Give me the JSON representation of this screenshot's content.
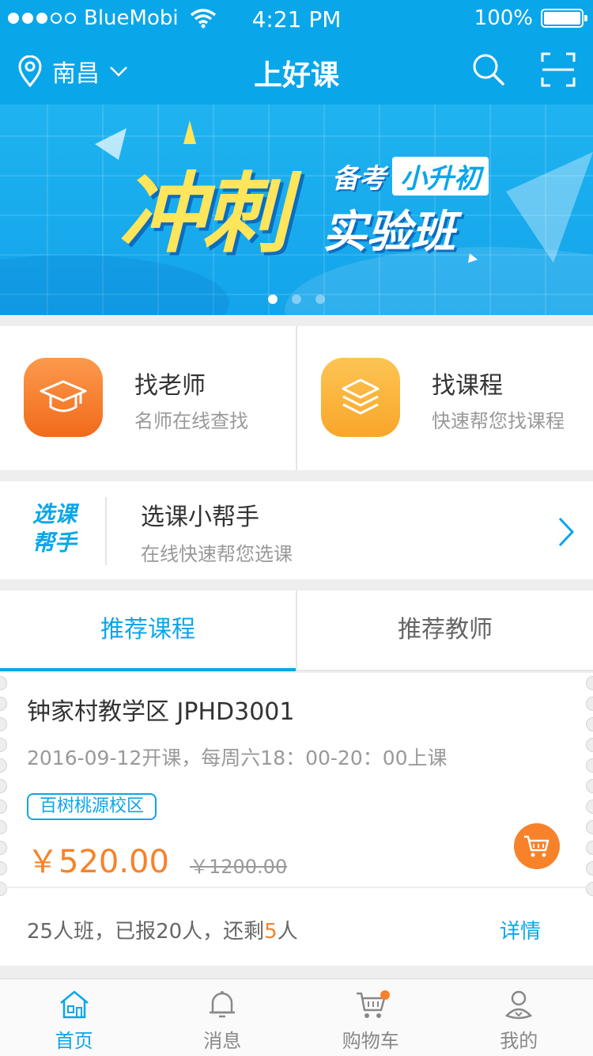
{
  "status_bar": {
    "carrier": "BlueMobi",
    "time": "4:21 PM",
    "battery": "100%"
  },
  "nav": {
    "city": "南昌",
    "title": "上好课"
  },
  "banner": {
    "big_text": "冲刺",
    "sub_prefix": "备考",
    "sub_tag": "小升初",
    "sub_main": "实验班",
    "page_count": 3,
    "active_page": 1
  },
  "quick_entries": [
    {
      "title": "找老师",
      "desc": "名师在线查找",
      "icon": "graduation-cap-icon",
      "color": "#f7822a"
    },
    {
      "title": "找课程",
      "desc": "快速帮您找课程",
      "icon": "layers-icon",
      "color": "#fbb03b"
    }
  ],
  "helper": {
    "logo_line1": "选课",
    "logo_line2": "帮手",
    "title": "选课小帮手",
    "desc": "在线快速帮您选课"
  },
  "tabs": [
    {
      "label": "推荐课程",
      "active": true
    },
    {
      "label": "推荐教师",
      "active": false
    }
  ],
  "course": {
    "title": "钟家村教学区 JPHD3001",
    "time": "2016-09-12开课，每周六18：00-20：00上课",
    "campus": "百树桃源校区",
    "price": "￥520.00",
    "original_price": "￥1200.00",
    "enroll_prefix": "25人班，已报20人，还剩",
    "remaining": "5",
    "enroll_suffix": "人",
    "detail": "详情"
  },
  "tabbar": [
    {
      "label": "首页",
      "icon": "home-icon",
      "active": true
    },
    {
      "label": "消息",
      "icon": "bell-icon",
      "active": false
    },
    {
      "label": "购物车",
      "icon": "cart-icon",
      "active": false,
      "badge": true
    },
    {
      "label": "我的",
      "icon": "user-icon",
      "active": false
    }
  ],
  "colors": {
    "primary": "#0aa6ea",
    "accent": "#f7822a",
    "banner_yellow": "#ffe55a"
  }
}
